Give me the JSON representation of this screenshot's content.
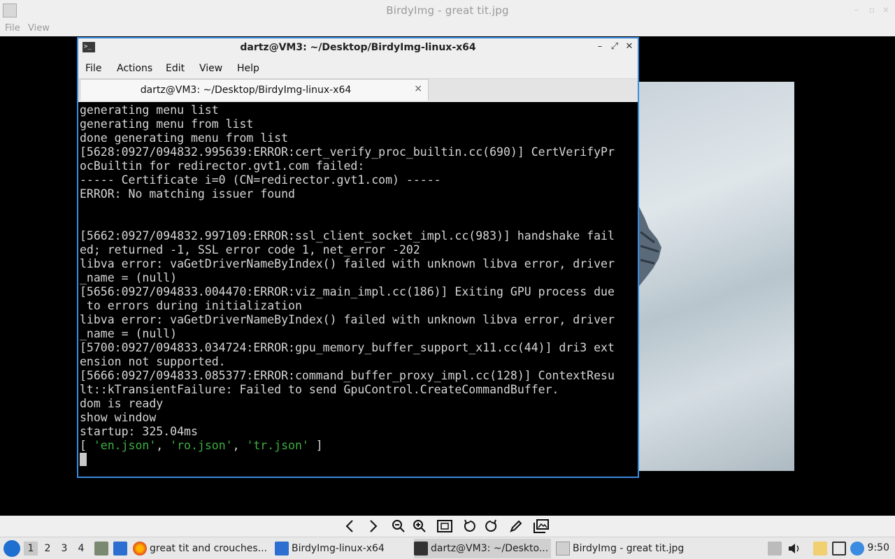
{
  "viewer": {
    "title": "BirdyImg - great tit.jpg",
    "menu": [
      "File",
      "View"
    ]
  },
  "terminal": {
    "title": "dartz@VM3: ~/Desktop/BirdyImg-linux-x64",
    "menu": [
      "File",
      "Actions",
      "Edit",
      "View",
      "Help"
    ],
    "tab_label": "dartz@VM3: ~/Desktop/BirdyImg-linux-x64",
    "tab_close": "×",
    "lines": [
      "generating menu list",
      "generating menu from list",
      "done generating menu from list",
      "[5628:0927/094832.995639:ERROR:cert_verify_proc_builtin.cc(690)] CertVerifyPr",
      "ocBuiltin for redirector.gvt1.com failed:",
      "----- Certificate i=0 (CN=redirector.gvt1.com) -----",
      "ERROR: No matching issuer found",
      "",
      "",
      "[5662:0927/094832.997109:ERROR:ssl_client_socket_impl.cc(983)] handshake fail",
      "ed; returned -1, SSL error code 1, net_error -202",
      "libva error: vaGetDriverNameByIndex() failed with unknown libva error, driver",
      "_name = (null)",
      "[5656:0927/094833.004470:ERROR:viz_main_impl.cc(186)] Exiting GPU process due",
      " to errors during initialization",
      "libva error: vaGetDriverNameByIndex() failed with unknown libva error, driver",
      "_name = (null)",
      "[5700:0927/094833.034724:ERROR:gpu_memory_buffer_support_x11.cc(44)] dri3 ext",
      "ension not supported.",
      "[5666:0927/094833.085377:ERROR:command_buffer_proxy_impl.cc(128)] ContextResu",
      "lt::kTransientFailure: Failed to send GpuControl.CreateCommandBuffer.",
      "dom is ready",
      "show window",
      "startup: 325.04ms"
    ],
    "json_list": {
      "open": "[ ",
      "items": [
        "'en.json'",
        "'ro.json'",
        "'tr.json'"
      ],
      "sep": ", ",
      "close": " ]"
    },
    "string_color": "#3cb043"
  },
  "toolbar_icons": [
    "prev-icon",
    "next-icon",
    "zoom-out-icon",
    "zoom-in-icon",
    "fit-icon",
    "rotate-left-icon",
    "rotate-right-icon",
    "edit-icon",
    "gallery-icon"
  ],
  "taskbar": {
    "workspaces": [
      "1",
      "2",
      "3",
      "4"
    ],
    "tasks": [
      {
        "label": "great tit and crouches..."
      },
      {
        "label": "BirdyImg-linux-x64"
      },
      {
        "label": "dartz@VM3: ~/Deskto..."
      },
      {
        "label": "BirdyImg - great tit.jpg"
      }
    ],
    "clock": "9:50"
  },
  "colors": {
    "accent": "#3b8be0",
    "terminal_bg": "#000000",
    "terminal_fg": "#d6d6d6"
  }
}
